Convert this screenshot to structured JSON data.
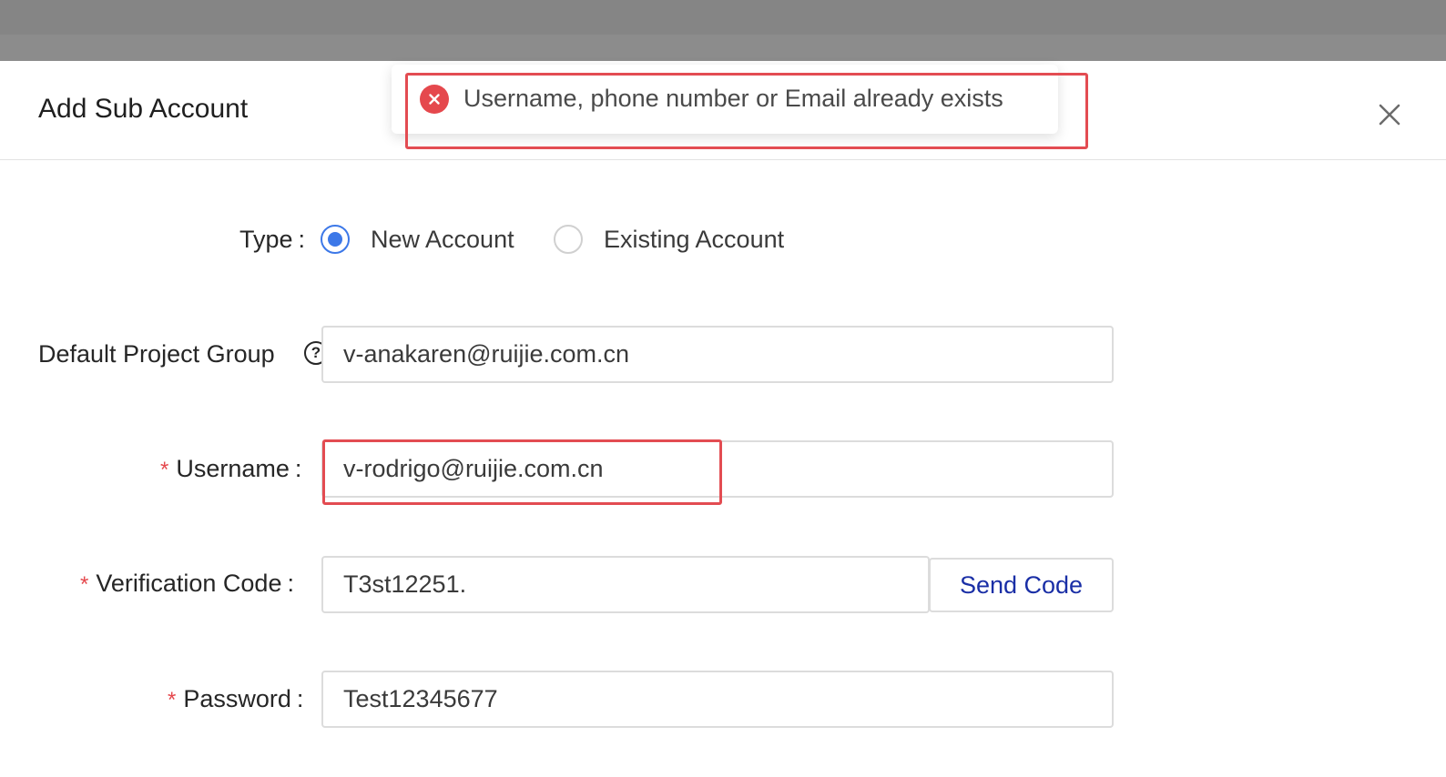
{
  "modal": {
    "title": "Add Sub Account"
  },
  "toast": {
    "type": "error",
    "message": "Username, phone number or Email already exists"
  },
  "form": {
    "type": {
      "label": "Type",
      "options": [
        {
          "label": "New Account",
          "selected": true
        },
        {
          "label": "Existing Account",
          "selected": false
        }
      ]
    },
    "default_project_group": {
      "label": "Default Project Group",
      "value": "v-anakaren@ruijie.com.cn"
    },
    "username": {
      "label": "Username",
      "required": true,
      "value": "v-rodrigo@ruijie.com.cn"
    },
    "verification_code": {
      "label": "Verification Code",
      "required": true,
      "value": "T3st12251.",
      "send_code_label": "Send Code"
    },
    "password": {
      "label": "Password",
      "required": true,
      "value": "Test12345677"
    }
  },
  "colors": {
    "accent": "#3c78e8",
    "error": "#e5484d",
    "link": "#1a2fa6",
    "highlight": "#e34c52"
  }
}
